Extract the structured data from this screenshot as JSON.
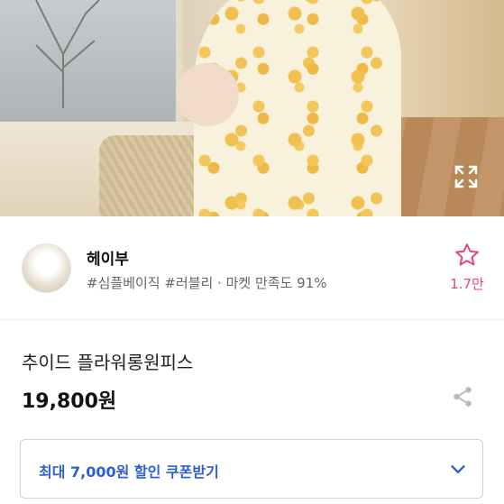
{
  "product_image": {
    "alt": "추이드 플라워롱원피스"
  },
  "icons": {
    "expand": "expand-icon",
    "favorite": "star-outline-icon",
    "share": "share-icon",
    "chevron": "chevron-down-icon"
  },
  "seller": {
    "name": "헤이부",
    "tags": "#심플베이직 #러블리 · 마켓 만족도 91%",
    "favorite_count": "1.7만"
  },
  "product": {
    "title": "추이드 플라워롱원피스",
    "price": "19,800원"
  },
  "coupon": {
    "label": "최대 7,000원 할인 쿠폰받기"
  },
  "colors": {
    "accent_pink": "#e9457a",
    "coupon_blue": "#2d5fd3"
  }
}
